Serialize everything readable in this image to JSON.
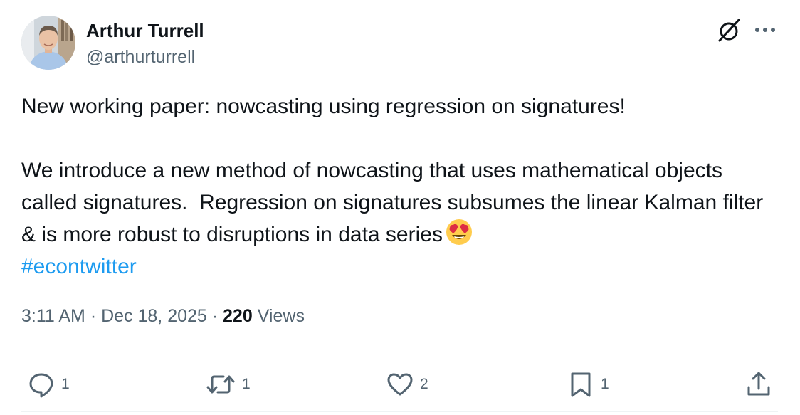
{
  "author": {
    "name": "Arthur Turrell",
    "handle": "@arthurturrell"
  },
  "tweet": {
    "line1": "New working paper: nowcasting using regression on signatures!",
    "line2": "We introduce a new method of nowcasting that uses mathematical objects called signatures.  Regression on signatures subsumes the linear Kalman filter & is more robust to disruptions in data series",
    "emoji": "smiling-face-with-heart-eyes",
    "hashtag": "#econtwitter"
  },
  "meta": {
    "time": "3:11 AM",
    "separator": " · ",
    "date": "Dec 18, 2025",
    "views_count": "220",
    "views_label": "Views"
  },
  "actions": {
    "reply_count": "1",
    "retweet_count": "1",
    "like_count": "2",
    "bookmark_count": "1"
  },
  "colors": {
    "accent": "#1d9bf0",
    "text": "#0f1419",
    "secondary": "#536471"
  },
  "icons": {
    "top": [
      "grok-icon",
      "more-icon"
    ],
    "actions": [
      "reply-icon",
      "retweet-icon",
      "like-icon",
      "bookmark-icon",
      "share-icon"
    ]
  }
}
